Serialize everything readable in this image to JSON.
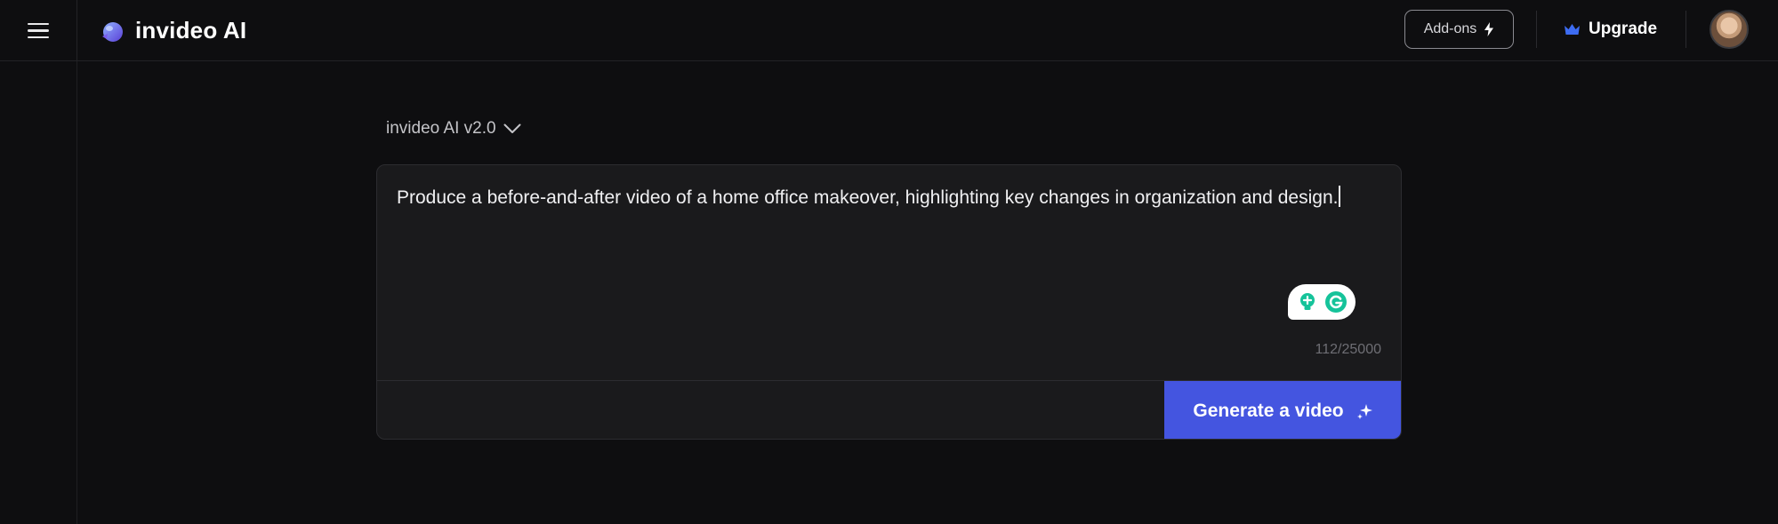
{
  "header": {
    "brand_name": "invideo AI",
    "addons_label": "Add-ons",
    "upgrade_label": "Upgrade"
  },
  "model_selector": {
    "label": "invideo AI v2.0"
  },
  "prompt": {
    "text": "Produce a before-and-after video of a home office makeover, highlighting key changes in organization and design.",
    "char_count": "112/25000"
  },
  "actions": {
    "generate_label": "Generate a video"
  },
  "colors": {
    "accent": "#4455e0",
    "background": "#0e0e10",
    "card": "#1a1a1c",
    "grammarly": "#15c39a"
  },
  "icons": {
    "menu": "hamburger-icon",
    "logo": "invideo-logo-icon",
    "addons": "bolt-icon",
    "upgrade": "crown-icon",
    "model": "chevron-down-icon",
    "grammarly": "grammarly-icon",
    "generate": "sparkle-icon"
  }
}
